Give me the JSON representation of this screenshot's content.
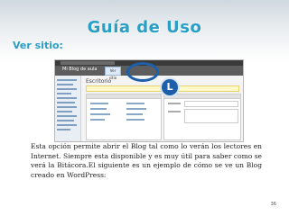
{
  "slide": {
    "title": "Guía de Uso",
    "subtitle": "Ver sitio:",
    "body": "Esta opción permite abrir el Blog tal como lo verán los lectores en Internet. Siempre esta disponible y es muy útil para saber como se verá la Bitácora.El siguiente es un ejemplo de cómo se ve un Blog creado en WordPress:",
    "page_number": "36"
  },
  "screenshot": {
    "blog_name": "Mi Blog de aula",
    "visit_button": "Ver sitio",
    "dashboard_title": "Escritorio",
    "callout_letter": "L"
  },
  "colors": {
    "accent": "#2a9fc6",
    "callout": "#1d5fa8"
  }
}
